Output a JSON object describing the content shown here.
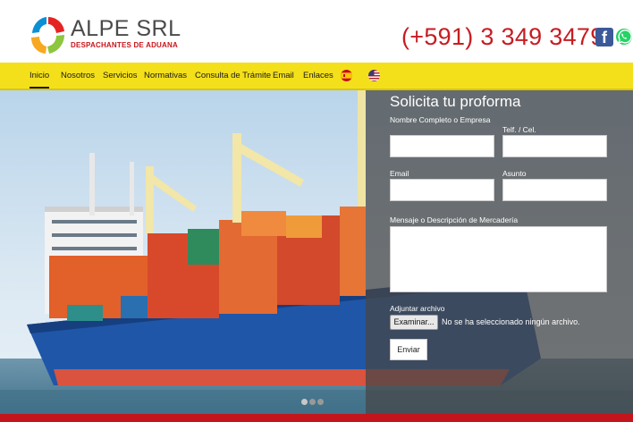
{
  "brand": {
    "name": "ALPE SRL",
    "tagline": "DESPACHANTES DE ADUANA",
    "phone": "(+591) 3 349 3479"
  },
  "nav": {
    "items": [
      "Inicio",
      "Nosotros",
      "Servicios",
      "Normativas",
      "Consulta de Trámite",
      "Email",
      "Enlaces"
    ],
    "active": "Inicio"
  },
  "form": {
    "title": "Solicita tu proforma",
    "name_label": "Nombre Completo o Empresa",
    "phone_label": "Telf. / Cel.",
    "email_label": "Email",
    "subject_label": "Asunto",
    "message_label": "Mensaje o Descripción de Mercadería",
    "file_label": "Adjuntar archivo",
    "file_button": "Examinar...",
    "file_status": "No se ha seleccionado ningún archivo.",
    "submit": "Enviar"
  },
  "colors": {
    "nav_bg": "#f4e01a",
    "accent_red": "#c61d22",
    "panel_bg": "#464646"
  },
  "icons": [
    "facebook-icon",
    "whatsapp-icon",
    "spain-flag-icon",
    "usa-flag-icon"
  ],
  "slider": {
    "slides": 3,
    "active": 1
  }
}
